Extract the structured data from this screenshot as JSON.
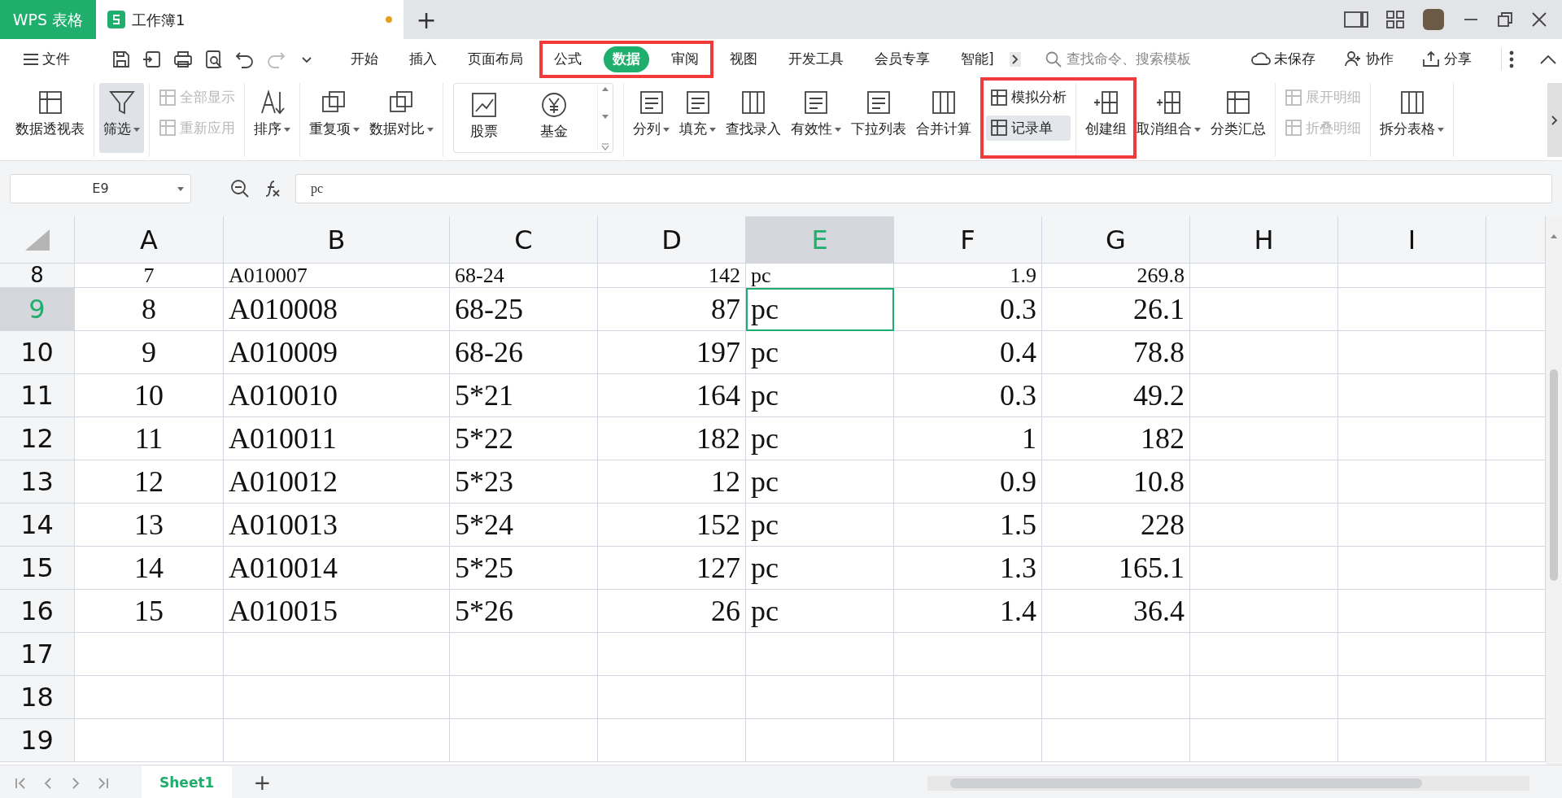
{
  "title_bar": {
    "app_tab": "WPS 表格",
    "doc_tab": {
      "title": "工作簿1",
      "unsaved": true
    },
    "new_tab": "+"
  },
  "menu": {
    "file": "文件",
    "tabs": [
      {
        "label": "开始",
        "selected": false
      },
      {
        "label": "插入",
        "selected": false
      },
      {
        "label": "页面布局",
        "selected": false
      },
      {
        "label": "公式",
        "selected": false
      },
      {
        "label": "数据",
        "selected": true
      },
      {
        "label": "审阅",
        "selected": false
      },
      {
        "label": "视图",
        "selected": false
      },
      {
        "label": "开发工具",
        "selected": false
      },
      {
        "label": "会员专享",
        "selected": false
      },
      {
        "label": "智能]",
        "selected": false
      }
    ],
    "search": {
      "placeholder": "查找命令、搜索模板"
    },
    "actions": [
      "未保存",
      "协作",
      "分享"
    ]
  },
  "ribbon": [
    {
      "kind": "large",
      "items": [
        {
          "label": "数据透视表",
          "dropdown": false,
          "pressed": false
        }
      ]
    },
    {
      "kind": "large",
      "items": [
        {
          "label": "筛选",
          "dropdown": true,
          "pressed": true
        }
      ]
    },
    {
      "kind": "stack",
      "items": [
        {
          "label": "全部显示",
          "disabled": true,
          "pressed": false
        },
        {
          "label": "重新应用",
          "disabled": true,
          "pressed": false
        }
      ]
    },
    {
      "kind": "large",
      "items": [
        {
          "label": "排序",
          "dropdown": true,
          "pressed": false
        }
      ]
    },
    {
      "kind": "large",
      "items": [
        {
          "label": "重复项",
          "dropdown": true,
          "pressed": false
        },
        {
          "label": "数据对比",
          "dropdown": true,
          "pressed": false
        }
      ]
    },
    {
      "kind": "gallery",
      "items": [
        {
          "label": "股票"
        },
        {
          "label": "基金"
        }
      ]
    },
    {
      "kind": "large",
      "items": [
        {
          "label": "分列",
          "dropdown": true,
          "pressed": false
        },
        {
          "label": "填充",
          "dropdown": true,
          "pressed": false
        },
        {
          "label": "查找录入",
          "dropdown": false,
          "pressed": false
        },
        {
          "label": "有效性",
          "dropdown": true,
          "pressed": false
        },
        {
          "label": "下拉列表",
          "dropdown": false,
          "pressed": false
        },
        {
          "label": "合并计算",
          "dropdown": false,
          "pressed": false
        }
      ]
    },
    {
      "kind": "stack",
      "items": [
        {
          "label": "模拟分析",
          "disabled": false,
          "pressed": false
        },
        {
          "label": "记录单",
          "disabled": false,
          "pressed": true
        }
      ]
    },
    {
      "kind": "large",
      "items": [
        {
          "label": "创建组",
          "dropdown": false,
          "pressed": false
        },
        {
          "label": "取消组合",
          "dropdown": true,
          "pressed": false
        },
        {
          "label": "分类汇总",
          "dropdown": false,
          "pressed": false
        }
      ]
    },
    {
      "kind": "stack",
      "items": [
        {
          "label": "展开明细",
          "disabled": true,
          "pressed": false
        },
        {
          "label": "折叠明细",
          "disabled": true,
          "pressed": false
        }
      ]
    },
    {
      "kind": "large",
      "items": [
        {
          "label": "拆分表格",
          "dropdown": true,
          "pressed": false
        }
      ]
    }
  ],
  "formula_bar": {
    "cell_ref": "E9",
    "value": "pc"
  },
  "sheet": {
    "columns": [
      {
        "label": "A",
        "selected": false
      },
      {
        "label": "B",
        "selected": false
      },
      {
        "label": "C",
        "selected": false
      },
      {
        "label": "D",
        "selected": false
      },
      {
        "label": "E",
        "selected": true
      },
      {
        "label": "F",
        "selected": false
      },
      {
        "label": "G",
        "selected": false
      },
      {
        "label": "H",
        "selected": false
      },
      {
        "label": "I",
        "selected": false
      }
    ],
    "rows": [
      {
        "number": "8",
        "selected": false,
        "cells": [
          "7",
          "A010007",
          "68-24",
          "142",
          "pc",
          "1.9",
          "269.8"
        ]
      },
      {
        "number": "9",
        "selected": true,
        "cells": [
          "8",
          "A010008",
          "68-25",
          "87",
          "pc",
          "0.3",
          "26.1"
        ]
      },
      {
        "number": "10",
        "selected": false,
        "cells": [
          "9",
          "A010009",
          "68-26",
          "197",
          "pc",
          "0.4",
          "78.8"
        ]
      },
      {
        "number": "11",
        "selected": false,
        "cells": [
          "10",
          "A010010",
          "5*21",
          "164",
          "pc",
          "0.3",
          "49.2"
        ]
      },
      {
        "number": "12",
        "selected": false,
        "cells": [
          "11",
          "A010011",
          "5*22",
          "182",
          "pc",
          "1",
          "182"
        ]
      },
      {
        "number": "13",
        "selected": false,
        "cells": [
          "12",
          "A010012",
          "5*23",
          "12",
          "pc",
          "0.9",
          "10.8"
        ]
      },
      {
        "number": "14",
        "selected": false,
        "cells": [
          "13",
          "A010013",
          "5*24",
          "152",
          "pc",
          "1.5",
          "228"
        ]
      },
      {
        "number": "15",
        "selected": false,
        "cells": [
          "14",
          "A010014",
          "5*25",
          "127",
          "pc",
          "1.3",
          "165.1"
        ]
      },
      {
        "number": "16",
        "selected": false,
        "cells": [
          "15",
          "A010015",
          "5*26",
          "26",
          "pc",
          "1.4",
          "36.4"
        ]
      },
      {
        "number": "17",
        "selected": false,
        "cells": []
      },
      {
        "number": "18",
        "selected": false,
        "cells": []
      },
      {
        "number": "19",
        "selected": false,
        "cells": []
      }
    ]
  },
  "sheet_tabs": {
    "tabs": [
      {
        "label": "Sheet1",
        "selected": true
      }
    ],
    "add": "+"
  }
}
